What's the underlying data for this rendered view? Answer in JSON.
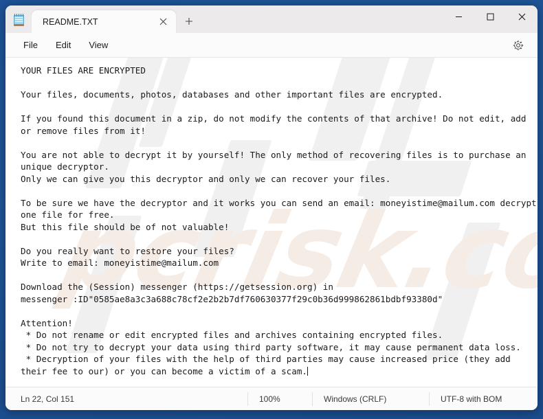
{
  "window": {
    "app_icon": "notepad-icon",
    "controls": {
      "minimize": "minimize-icon",
      "maximize": "maximize-icon",
      "close": "close-icon"
    }
  },
  "tabs": [
    {
      "title": "README.TXT",
      "close_icon": "close-icon",
      "active": true
    }
  ],
  "new_tab_label": "+",
  "menu": {
    "items": [
      "File",
      "Edit",
      "View"
    ],
    "settings_icon": "gear-icon"
  },
  "document": {
    "filename": "README.TXT",
    "lines": [
      "YOUR FILES ARE ENCRYPTED",
      "",
      "Your files, documents, photos, databases and other important files are encrypted.",
      "",
      "If you found this document in a zip, do not modify the contents of that archive! Do not edit, add or remove files from it!",
      "",
      "You are not able to decrypt it by yourself! The only method of recovering files is to purchase an unique decryptor.",
      "Only we can give you this decryptor and only we can recover your files.",
      "",
      "To be sure we have the decryptor and it works you can send an email: moneyistime@mailum.com decrypt one file for free.",
      "But this file should be of not valuable!",
      "",
      "Do you really want to restore your files?",
      "Write to email: moneyistime@mailum.com",
      "",
      "Download the (Session) messenger (https://getsession.org) in",
      "messenger :ID\"0585ae8a3c3a688c78cf2e2b2b7df760630377f29c0b36d999862861bdbf93380d\"",
      "",
      "Attention!",
      " * Do not rename or edit encrypted files and archives containing encrypted files.",
      " * Do not try to decrypt your data using third party software, it may cause permanent data loss.",
      " * Decryption of your files with the help of third parties may cause increased price (they add their fee to our) or you can become a victim of a scam."
    ],
    "email": "moneyistime@mailum.com",
    "session_url": "https://getsession.org",
    "session_id": "0585ae8a3c3a688c78cf2e2b2b7df760630377f29c0b36d999862861bdbf93380d"
  },
  "watermark": {
    "text": "pcrisk.com"
  },
  "statusbar": {
    "position": "Ln 22, Col 151",
    "zoom": "100%",
    "line_ending": "Windows (CRLF)",
    "encoding": "UTF-8 with BOM"
  },
  "colors": {
    "desktop": "#1f5496",
    "window": "#ffffff",
    "titlebar": "#eceaea",
    "chrome": "#fbfbfb",
    "text": "#1a1a1a",
    "accent_close": "#c42b1c"
  }
}
